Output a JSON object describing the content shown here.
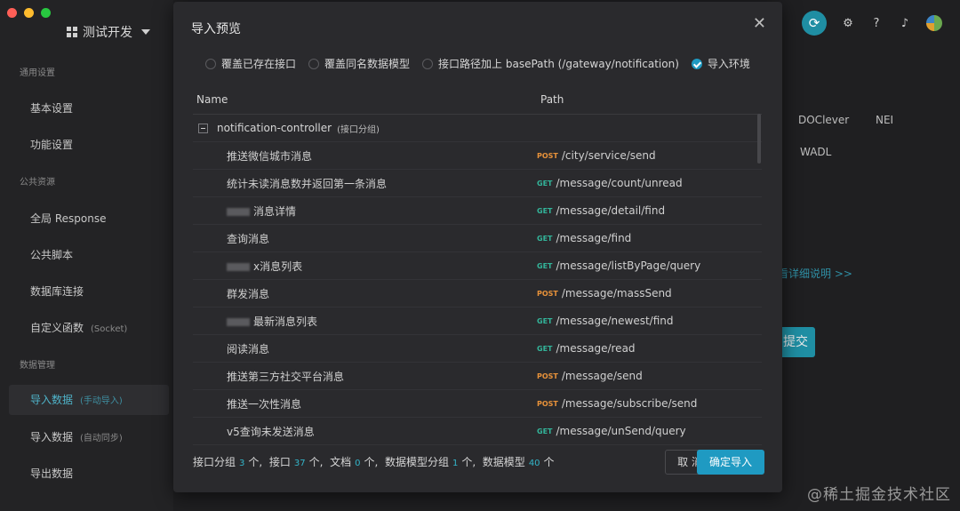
{
  "sidebar": {
    "project_name": "测试开发",
    "sections": [
      "通用设置",
      "公共资源",
      "数据管理"
    ],
    "items": [
      {
        "label": "基本设置"
      },
      {
        "label": "功能设置"
      },
      {
        "label": "全局 Response"
      },
      {
        "label": "公共脚本"
      },
      {
        "label": "数据库连接"
      },
      {
        "label": "自定义函数",
        "sub": "(Socket)"
      },
      {
        "label": "导入数据",
        "sub": "(手动导入)"
      },
      {
        "label": "导入数据",
        "sub": "(自动同步)"
      },
      {
        "label": "导出数据"
      }
    ]
  },
  "background": {
    "formats": [
      "DOClever",
      "NEI",
      "WADL"
    ],
    "link_text": "看详细说明 >>",
    "submit_label": "提交"
  },
  "modal": {
    "title": "导入预览",
    "options": [
      {
        "label": "覆盖已存在接口",
        "checked": false
      },
      {
        "label": "覆盖同名数据模型",
        "checked": false
      },
      {
        "label": "接口路径加上 basePath (/gateway/notification)",
        "checked": false
      },
      {
        "label": "导入环境",
        "checked": true
      }
    ],
    "columns": {
      "name": "Name",
      "path": "Path"
    },
    "group": {
      "name": "notification-controller",
      "tag": "(接口分组)"
    },
    "rows": [
      {
        "name": "推送微信城市消息",
        "method": "POST",
        "path": "/city/service/send"
      },
      {
        "name": "统计未读消息数并返回第一条消息",
        "method": "GET",
        "path": "/message/count/unread"
      },
      {
        "name": "消息详情",
        "method": "GET",
        "path": "/message/detail/find",
        "redacted": true
      },
      {
        "name": "查询消息",
        "method": "GET",
        "path": "/message/find"
      },
      {
        "name": "x消息列表",
        "method": "GET",
        "path": "/message/listByPage/query",
        "redacted": true
      },
      {
        "name": "群发消息",
        "method": "POST",
        "path": "/message/massSend"
      },
      {
        "name": "最新消息列表",
        "method": "GET",
        "path": "/message/newest/find",
        "redacted": true
      },
      {
        "name": "阅读消息",
        "method": "GET",
        "path": "/message/read"
      },
      {
        "name": "推送第三方社交平台消息",
        "method": "POST",
        "path": "/message/send"
      },
      {
        "name": "推送一次性消息",
        "method": "POST",
        "path": "/message/subscribe/send"
      },
      {
        "name": "v5查询未发送消息",
        "method": "GET",
        "path": "/message/unSend/query"
      }
    ],
    "footer": {
      "groups_label": "接口分组",
      "groups": "3",
      "groups_unit": "个,",
      "apis_label": "接口",
      "apis": "37",
      "apis_unit": "个,",
      "docs_label": "文档",
      "docs": "0",
      "docs_unit": "个,",
      "model_groups_label": "数据模型分组",
      "model_groups": "1",
      "model_groups_unit": "个,",
      "models_label": "数据模型",
      "models": "40",
      "models_unit": "个"
    },
    "cancel_label": "取 消",
    "confirm_label": "确定导入"
  },
  "watermark": "@稀土掘金技术社区",
  "colors": {
    "accent": "#1f9ac2",
    "post": "#e8923a",
    "get": "#33b59a"
  }
}
